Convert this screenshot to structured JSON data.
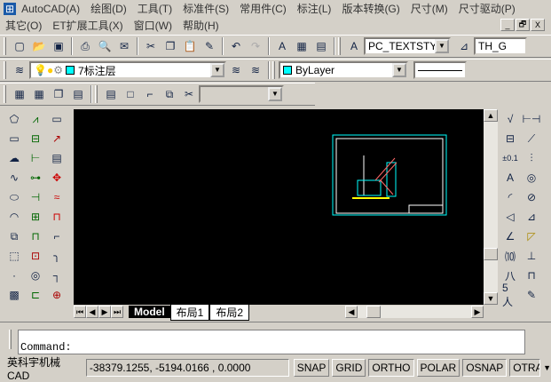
{
  "menu": {
    "row1": [
      "AutoCAD(A)",
      "绘图(D)",
      "工具(T)",
      "标准件(S)",
      "常用件(C)",
      "标注(L)",
      "版本转换(G)",
      "尺寸(M)",
      "尺寸驱动(P)"
    ],
    "row2": [
      "其它(O)",
      "ET扩展工具(X)",
      "窗口(W)",
      "帮助(H)"
    ]
  },
  "window_controls": [
    "_",
    "🗗",
    "X"
  ],
  "toolbar": {
    "text_style": "PC_TEXTSTYL",
    "dim_style": "TH_G",
    "layer": "7标注层",
    "color": "ByLayer",
    "empty_combo": ""
  },
  "colors": {
    "layer_swatch": "#00ffff",
    "canvas": "#000000",
    "frame": "#00ffff"
  },
  "tabs": {
    "model": "Model",
    "layout1": "布局1",
    "layout2": "布局2"
  },
  "command": {
    "prompt": "Command:"
  },
  "status": {
    "app": "英科宇机械CAD",
    "coords": "-38379.1255, -5194.0166 , 0.0000",
    "buttons": [
      "SNAP",
      "GRID",
      "ORTHO",
      "POLAR",
      "OSNAP",
      "OTRA"
    ]
  }
}
